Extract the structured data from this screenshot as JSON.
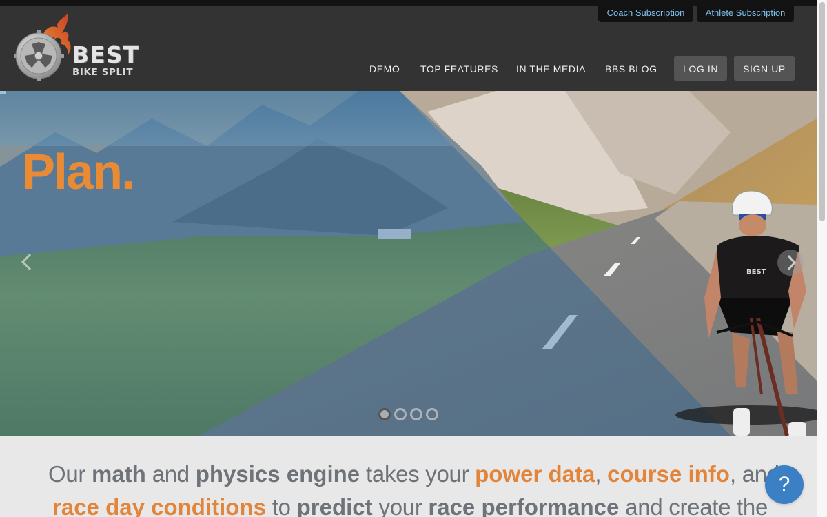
{
  "header": {
    "subscriptions": {
      "coach_label": "Coach Subscription",
      "athlete_label": "Athlete Subscription"
    },
    "logo": {
      "main_text": "BEST",
      "sub_text": "BIKE SPLIT"
    },
    "nav": {
      "demo": "DEMO",
      "top_features": "TOP FEATURES",
      "in_the_media": "IN THE MEDIA",
      "bbs_blog": "BBS BLOG",
      "log_in": "LOG IN",
      "sign_up": "SIGN UP"
    }
  },
  "hero": {
    "slide_title": "Plan.",
    "prev_icon": "chevron-left-icon",
    "next_icon": "chevron-right-icon",
    "slide_count": 4,
    "active_slide": 1,
    "jersey_text": "BEST"
  },
  "tagline": {
    "line1": {
      "w1": "Our ",
      "w2": "math",
      "w3": " and ",
      "w4": "physics engine",
      "w5": " takes your ",
      "w6": "power data",
      "w7": ", ",
      "w8": "course info",
      "w9": ", and"
    },
    "line2": {
      "w1": "race day conditions",
      "w2": " to ",
      "w3": "predict",
      "w4": " your ",
      "w5": "race performance",
      "w6": " and create the"
    }
  },
  "help": {
    "label": "?"
  },
  "colors": {
    "accent_orange": "#e98a35",
    "header_bg": "#333333",
    "subscription_text": "#7fc1ec",
    "help_blue": "#3b7fc4",
    "tagline_gray": "#6d7378"
  }
}
